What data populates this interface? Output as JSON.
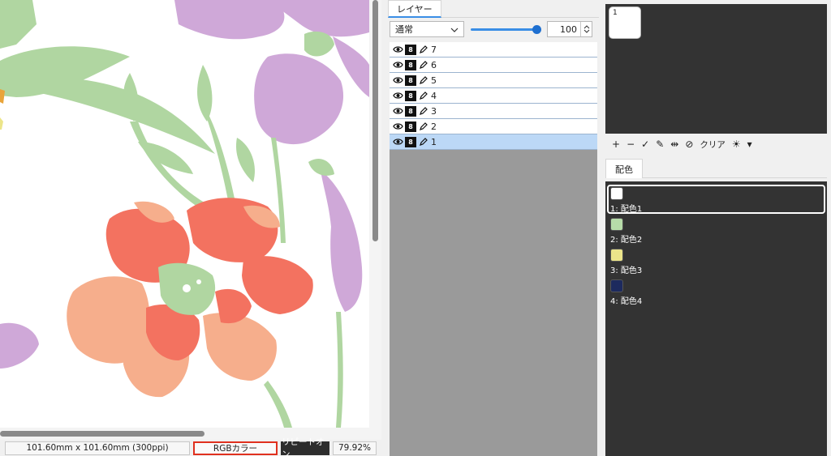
{
  "statusbar": {
    "size_text": "101.60mm x 101.60mm (300ppi)",
    "color_mode": "RGBカラー",
    "repeat": "リピートオン",
    "zoom": "79.92%"
  },
  "layers_panel": {
    "tab_label": "レイヤー",
    "blend_mode": "通常",
    "opacity_value": "100",
    "opacity_level_percent": 100,
    "layers": [
      {
        "name": "7",
        "selected": false
      },
      {
        "name": "6",
        "selected": false
      },
      {
        "name": "5",
        "selected": false
      },
      {
        "name": "4",
        "selected": false
      },
      {
        "name": "3",
        "selected": false
      },
      {
        "name": "2",
        "selected": false
      },
      {
        "name": "1",
        "selected": true
      }
    ]
  },
  "thumbnails": {
    "items": [
      {
        "label": "1"
      }
    ],
    "clear_label": "クリア"
  },
  "palette": {
    "tab_label": "配色",
    "swatches": [
      {
        "label": "1: 配色1",
        "color": "#ffffff",
        "selected": true
      },
      {
        "label": "2: 配色2",
        "color": "#b7dca9",
        "selected": false
      },
      {
        "label": "3: 配色3",
        "color": "#ece58a",
        "selected": false
      },
      {
        "label": "4: 配色4",
        "color": "#1d2a5e",
        "selected": false
      }
    ]
  },
  "colors": {
    "accent": "#3a8ee6",
    "highlight_box": "#e0301e",
    "panel_dark": "#333333",
    "petal_red": "#f37260",
    "petal_salmon": "#f6ae8c",
    "leaf_green": "#b0d6a1",
    "lavender": "#cfa8d8"
  }
}
